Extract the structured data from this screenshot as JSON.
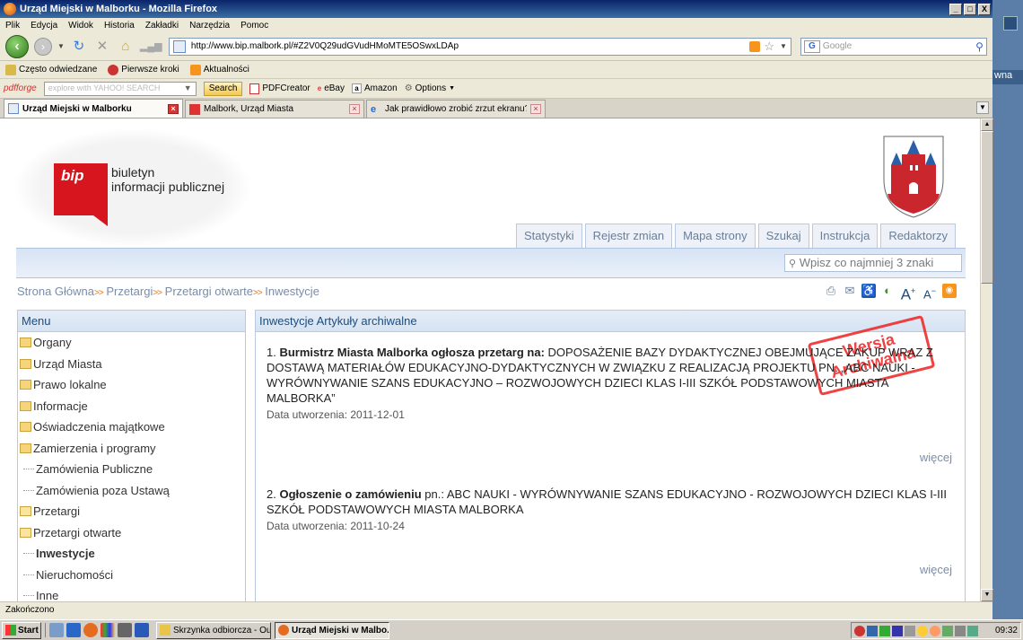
{
  "window": {
    "title": "Urząd Miejski w Malborku - Mozilla Firefox",
    "min": "_",
    "max": "□",
    "close": "X"
  },
  "menubar": [
    "Plik",
    "Edycja",
    "Widok",
    "Historia",
    "Zakładki",
    "Narzędzia",
    "Pomoc"
  ],
  "nav": {
    "url": "http://www.bip.malbork.pl/#Z2V0Q29udGVudHMoMTE5OSwxLDAp",
    "search_placeholder": "Google"
  },
  "bookmarks": [
    "Często odwiedzane",
    "Pierwsze kroki",
    "Aktualności"
  ],
  "pdfbar": {
    "logo": "pdfforge",
    "yahoo_placeholder": "explore with YAHOO! SEARCH",
    "search_label": "Search",
    "items": [
      "PDFCreator",
      "eBay",
      "Amazon",
      "Options"
    ]
  },
  "tabs": [
    {
      "label": "Urząd Miejski w Malborku",
      "active": true
    },
    {
      "label": "Malbork, Urząd Miasta",
      "active": false
    },
    {
      "label": "Jak prawidłowo zrobić zrzut ekranu?",
      "active": false
    }
  ],
  "page": {
    "logo_word": "bip",
    "logo_text_line1": "biuletyn",
    "logo_text_line2": "informacji publicznej",
    "topnav": [
      "Statystyki",
      "Rejestr zmian",
      "Mapa strony",
      "Szukaj",
      "Instrukcja",
      "Redaktorzy"
    ],
    "search_placeholder": "Wpisz co najmniej 3 znaki",
    "breadcrumb": [
      "Strona Główna",
      "Przetargi",
      "Przetargi otwarte",
      "Inwestycje"
    ],
    "breadcrumb_sep": ">>",
    "menu_title": "Menu",
    "menu_items": [
      {
        "label": "Organy",
        "level": 0,
        "type": "folder"
      },
      {
        "label": "Urząd Miasta",
        "level": 0,
        "type": "folder"
      },
      {
        "label": "Prawo lokalne",
        "level": 0,
        "type": "folder"
      },
      {
        "label": "Informacje",
        "level": 0,
        "type": "folder"
      },
      {
        "label": "Oświadczenia majątkowe",
        "level": 0,
        "type": "folder"
      },
      {
        "label": "Zamierzenia i programy",
        "level": 0,
        "type": "folder"
      },
      {
        "label": "Zamówienia Publiczne",
        "level": 0,
        "type": "leaf"
      },
      {
        "label": "Zamówienia poza Ustawą",
        "level": 0,
        "type": "leaf"
      },
      {
        "label": "Przetargi",
        "level": 0,
        "type": "folder-open"
      },
      {
        "label": "Przetargi otwarte",
        "level": 1,
        "type": "folder-open"
      },
      {
        "label": "Inwestycje",
        "level": 2,
        "type": "leaf",
        "bold": true
      },
      {
        "label": "Nieruchomości",
        "level": 2,
        "type": "leaf"
      },
      {
        "label": "Inne",
        "level": 2,
        "type": "leaf"
      }
    ],
    "content_title": "Inwestycje Artykuły archiwalne",
    "stamp_line1": "Wersja",
    "stamp_line2": "Archiwalna",
    "articles": [
      {
        "num": "1.",
        "title_bold": "Burmistrz Miasta Malborka ogłosza przetarg na:",
        "title_rest": " DOPOSAŻENIE BAZY DYDAKTYCZNEJ OBEJMUJĄCE ZAKUP WRAZ Z DOSTAWĄ MATERIAŁÓW EDUKACYJNO-DYDAKTYCZNYCH W ZWIĄZKU Z REALIZACJĄ PROJEKTU PN. „ABC NAUKI - WYRÓWNYWANIE SZANS EDUKACYJNO – ROZWOJOWYCH DZIECI KLAS I-III SZKÓŁ PODSTAWOWYCH MIASTA MALBORKA”",
        "date": "Data utworzenia: 2011-12-01",
        "more": "więcej"
      },
      {
        "num": "2.",
        "title_bold": "Ogłoszenie o zamówieniu",
        "title_rest": " pn.: ABC NAUKI - WYRÓWNYWANIE SZANS EDUKACYJNO - ROZWOJOWYCH DZIECI KLAS I-III SZKÓŁ PODSTAWOWYCH MIASTA MALBORKA",
        "date": "Data utworzenia: 2011-10-24",
        "more": "więcej"
      }
    ]
  },
  "status": "Zakończono",
  "taskbar": {
    "start": "Start",
    "buttons": [
      {
        "label": "Skrzynka odbiorcza - Outl...",
        "active": false
      },
      {
        "label": "Urząd Miejski w Malbo...",
        "active": true
      }
    ],
    "clock": "09:32"
  },
  "desktop_label": "wna"
}
